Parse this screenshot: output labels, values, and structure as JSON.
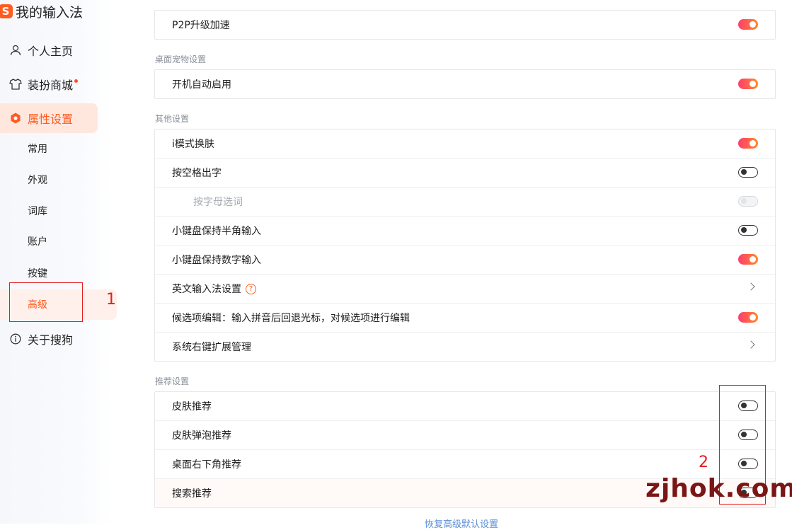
{
  "app": {
    "title": "我的输入法",
    "logo_char": "S"
  },
  "sidebar": {
    "items": [
      {
        "label": "个人主页",
        "icon": "user-icon"
      },
      {
        "label": "装扮商城",
        "icon": "shirt-icon",
        "badge_dot": true
      },
      {
        "label": "属性设置",
        "icon": "settings-hex-icon",
        "active": true
      },
      {
        "label": "关于搜狗",
        "icon": "info-icon"
      }
    ],
    "sub_items": [
      "常用",
      "外观",
      "词库",
      "账户",
      "按键",
      "高级"
    ],
    "active_sub_item": "高级"
  },
  "annotations": {
    "box1_number": "1",
    "box2_number": "2"
  },
  "sections": {
    "top": {
      "rows": [
        {
          "label": "P2P升级加速",
          "toggle": "on"
        }
      ]
    },
    "desktop_pet": {
      "title": "桌面宠物设置",
      "rows": [
        {
          "label": "开机自动启用",
          "toggle": "on"
        }
      ]
    },
    "other": {
      "title": "其他设置",
      "rows": [
        {
          "label": "i模式换肤",
          "toggle": "on"
        },
        {
          "label": "按空格出字",
          "toggle": "off"
        },
        {
          "label": "按字母选词",
          "toggle": "disabled"
        },
        {
          "label": "小键盘保持半角输入",
          "toggle": "off"
        },
        {
          "label": "小键盘保持数字输入",
          "toggle": "on"
        },
        {
          "label": "英文输入法设置",
          "help_icon": "?",
          "chevron": true
        },
        {
          "label": "候选项编辑：输入拼音后回退光标，对候选项进行编辑",
          "toggle": "on"
        },
        {
          "label": "系统右键扩展管理",
          "chevron": true
        }
      ]
    },
    "recommend": {
      "title": "推荐设置",
      "rows": [
        {
          "label": "皮肤推荐",
          "toggle": "off"
        },
        {
          "label": "皮肤弹泡推荐",
          "toggle": "off"
        },
        {
          "label": "桌面右下角推荐",
          "toggle": "off"
        },
        {
          "label": "搜索推荐",
          "toggle": "off"
        }
      ]
    }
  },
  "footer": {
    "reset_label": "恢复高级默认设置"
  },
  "watermark": "zjhok.com",
  "colors": {
    "accent": "#ff5a1f",
    "annotation": "#e41e1e"
  }
}
